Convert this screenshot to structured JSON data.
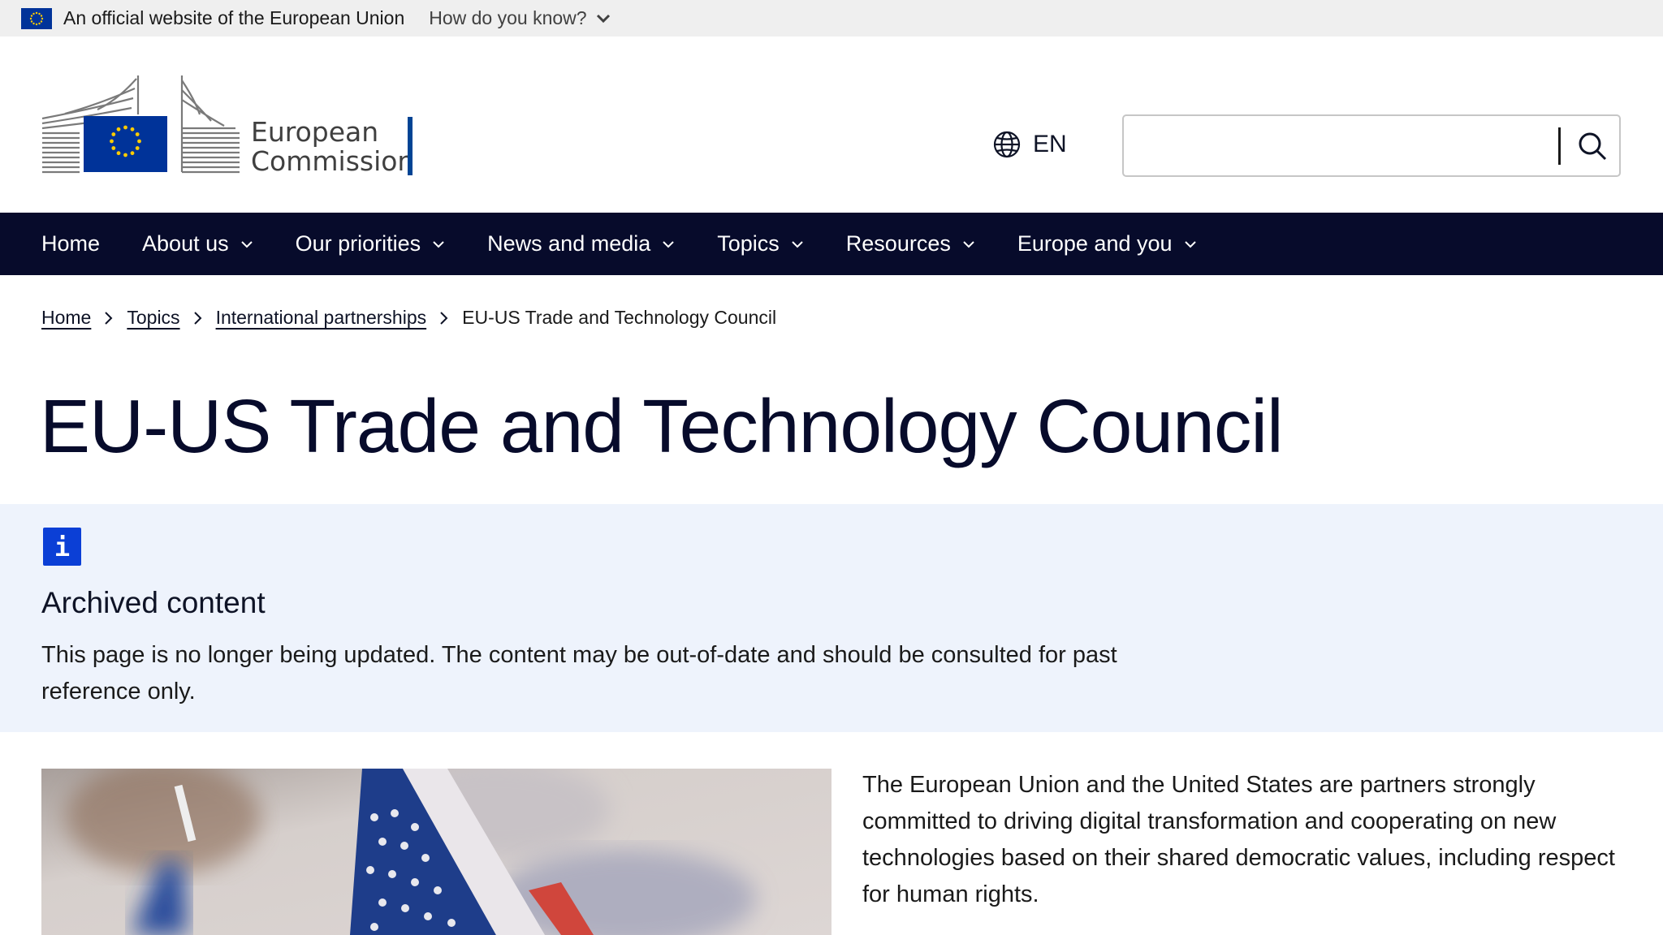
{
  "eu_banner": {
    "text": "An official website of the European Union",
    "how_know": "How do you know?"
  },
  "header": {
    "logo_line1": "European",
    "logo_line2": "Commission",
    "language": "EN",
    "search_placeholder": ""
  },
  "nav": {
    "items": [
      {
        "label": "Home",
        "has_dropdown": false
      },
      {
        "label": "About us",
        "has_dropdown": true
      },
      {
        "label": "Our priorities",
        "has_dropdown": true
      },
      {
        "label": "News and media",
        "has_dropdown": true
      },
      {
        "label": "Topics",
        "has_dropdown": true
      },
      {
        "label": "Resources",
        "has_dropdown": true
      },
      {
        "label": "Europe and you",
        "has_dropdown": true
      }
    ]
  },
  "breadcrumb": {
    "items": [
      "Home",
      "Topics",
      "International partnerships"
    ],
    "current": "EU-US Trade and Technology Council"
  },
  "page": {
    "title": "EU-US Trade and Technology Council"
  },
  "notice": {
    "icon": "i",
    "title": "Archived content",
    "text": "This page is no longer being updated. The content may be out-of-date and should be consulted for past reference only."
  },
  "content": {
    "intro": "The European Union and the United States are partners strongly committed to driving digital transformation and cooperating on new technologies based on their shared democratic values, including respect for human rights."
  },
  "colors": {
    "nav_bg": "#070b2b",
    "notice_bg": "#eef3fc",
    "info_blue": "#0b3fd6",
    "brand_blue": "#004494"
  }
}
